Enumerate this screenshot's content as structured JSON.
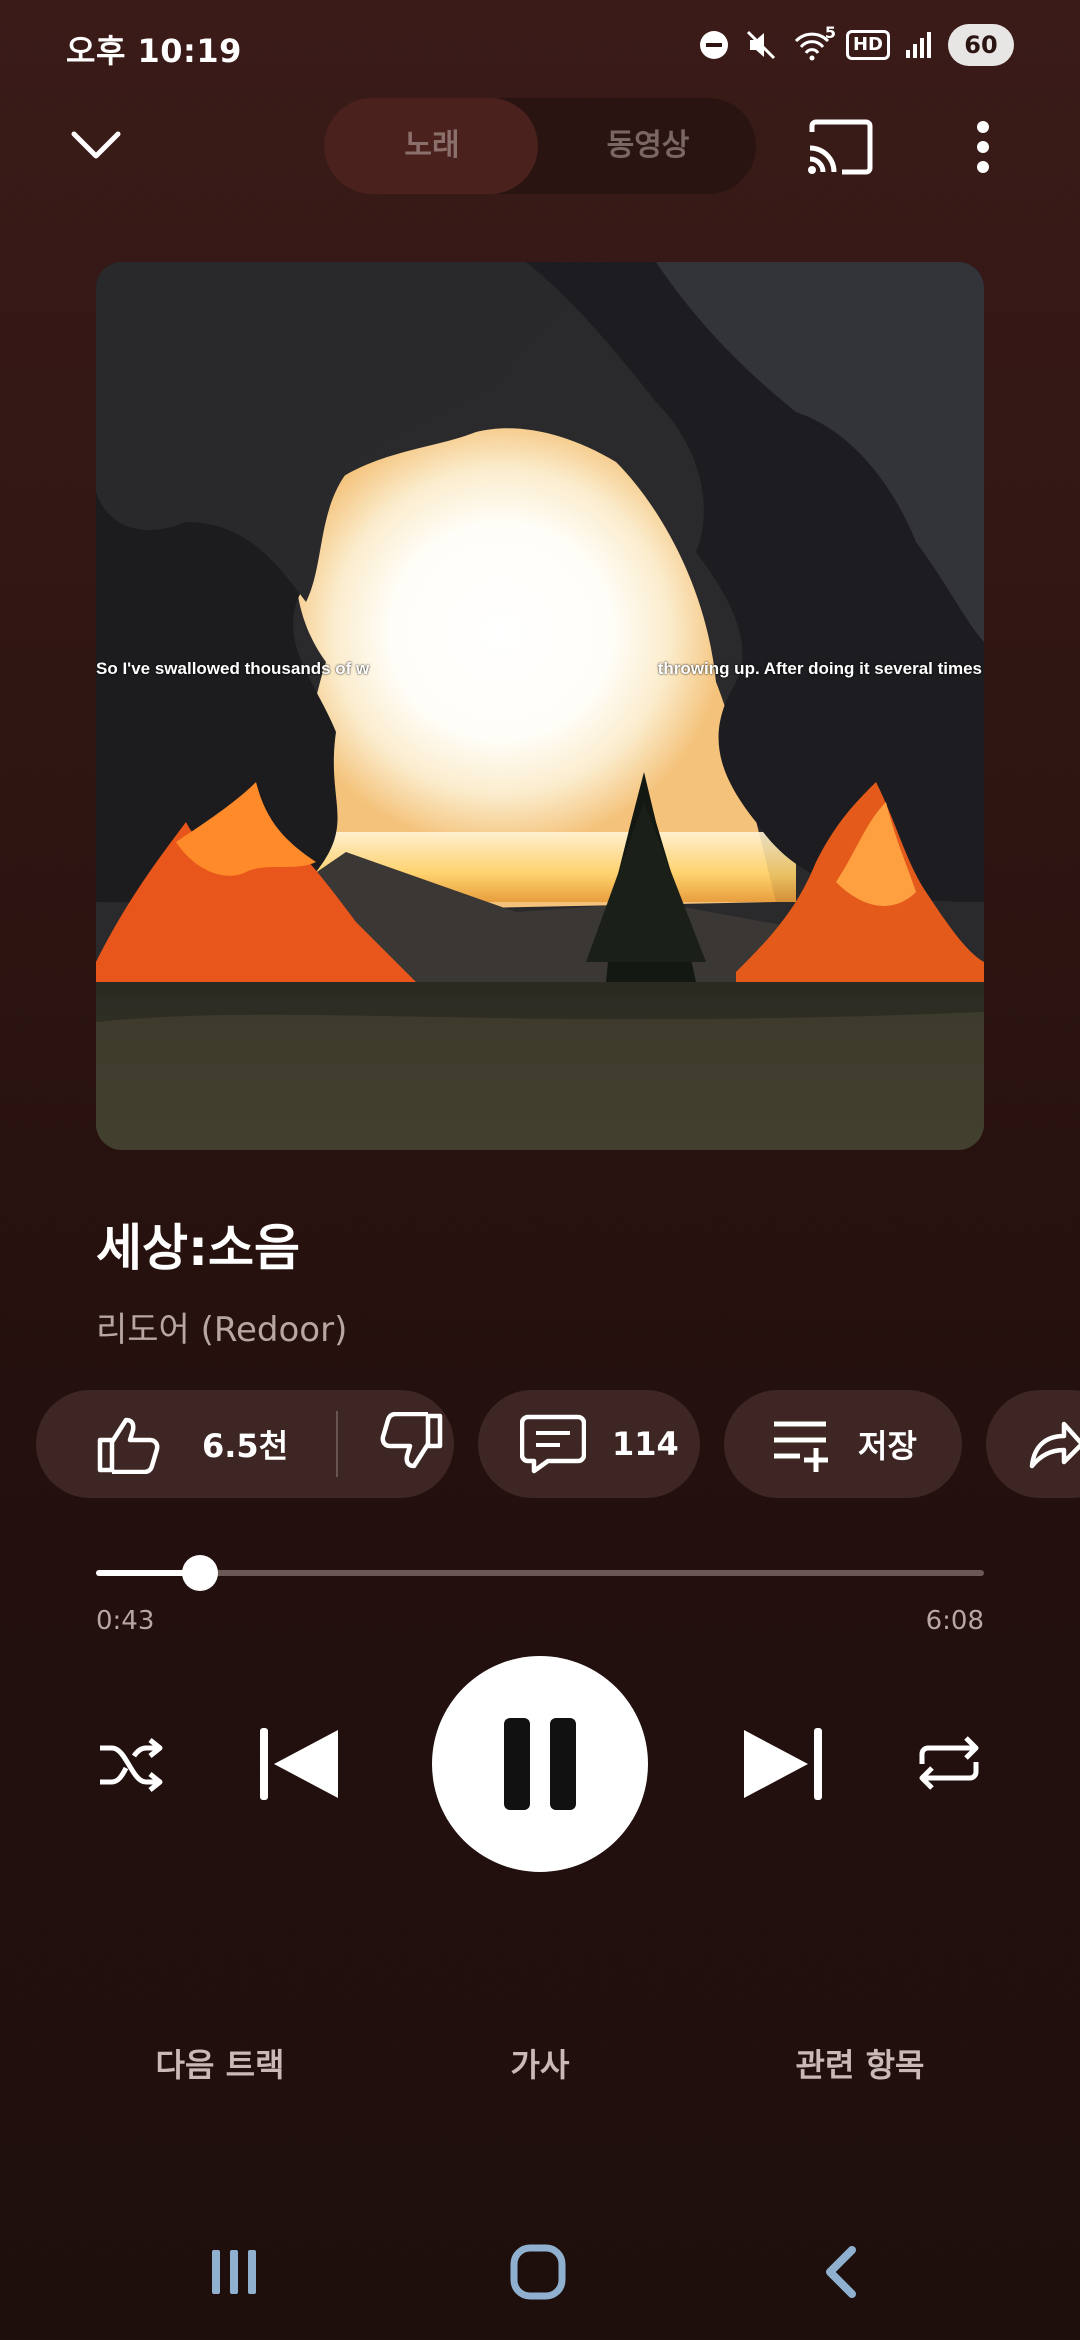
{
  "status_bar": {
    "time": "오후 10:19",
    "network_badge": "HD",
    "wifi_label": "5",
    "battery": "60"
  },
  "header": {
    "tabs": [
      {
        "label": "노래",
        "selected": true
      },
      {
        "label": "동영상",
        "selected": false
      }
    ]
  },
  "album_art": {
    "overlay_text_left": "So I've swallowed thousands of w",
    "overlay_text_right": "throwing up. After doing it several times"
  },
  "song": {
    "title": "세상:소음",
    "artist": "리도어 (Redoor)"
  },
  "actions": {
    "like_count": "6.5천",
    "comment_count": "114",
    "save_label": "저장"
  },
  "playback": {
    "current_time": "0:43",
    "total_time": "6:08",
    "progress": 0.117,
    "state": "playing"
  },
  "bottom_tabs": {
    "up_next": "다음 트랙",
    "lyrics": "가사",
    "related": "관련 항목"
  },
  "colors": {
    "background": "#2e1512",
    "chip": "#3d2623",
    "toggle_selected": "#4a211c"
  }
}
